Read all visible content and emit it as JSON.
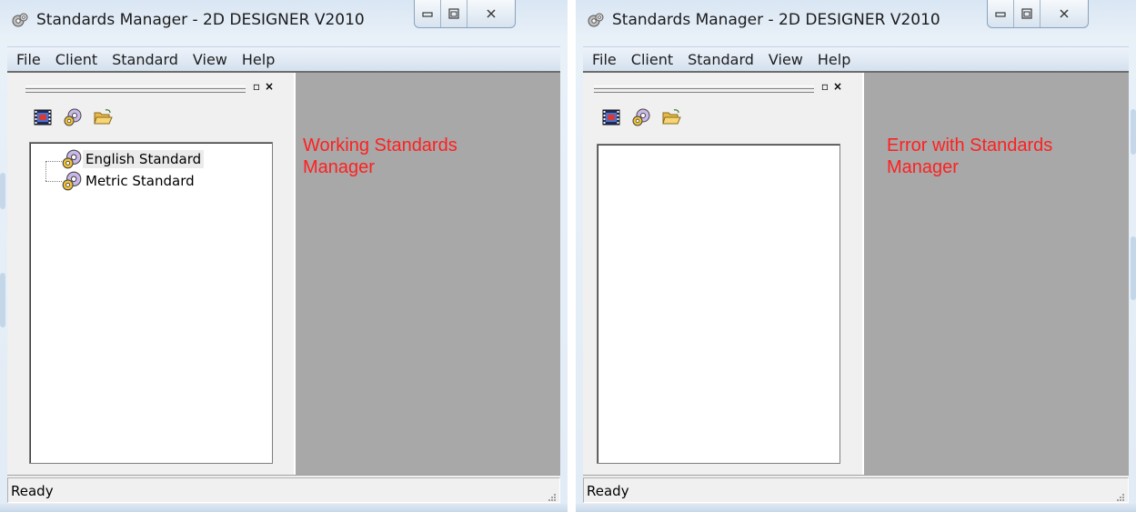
{
  "windows": [
    {
      "id": "working",
      "title": "Standards Manager - 2D DESIGNER V2010",
      "menu": [
        "File",
        "Client",
        "Standard",
        "View",
        "Help"
      ],
      "toolbar_icons": [
        "film-icon",
        "gears-icon",
        "open-folder-icon"
      ],
      "tree_items": [
        {
          "label": "English Standard",
          "icon": "gears-icon",
          "selected": true
        },
        {
          "label": "Metric Standard",
          "icon": "gears-icon",
          "selected": false
        }
      ],
      "annotation": [
        "Working Standards",
        "Manager"
      ],
      "status": "Ready"
    },
    {
      "id": "error",
      "title": "Standards Manager - 2D DESIGNER V2010",
      "menu": [
        "File",
        "Client",
        "Standard",
        "View",
        "Help"
      ],
      "toolbar_icons": [
        "film-icon",
        "gears-icon",
        "open-folder-icon"
      ],
      "tree_items": [],
      "annotation": [
        "Error with Standards",
        "Manager"
      ],
      "status": "Ready"
    }
  ],
  "colors": {
    "annotation": "#ff2020",
    "mdi_background": "#a8a8a8",
    "glass": "#d9e6f3"
  }
}
